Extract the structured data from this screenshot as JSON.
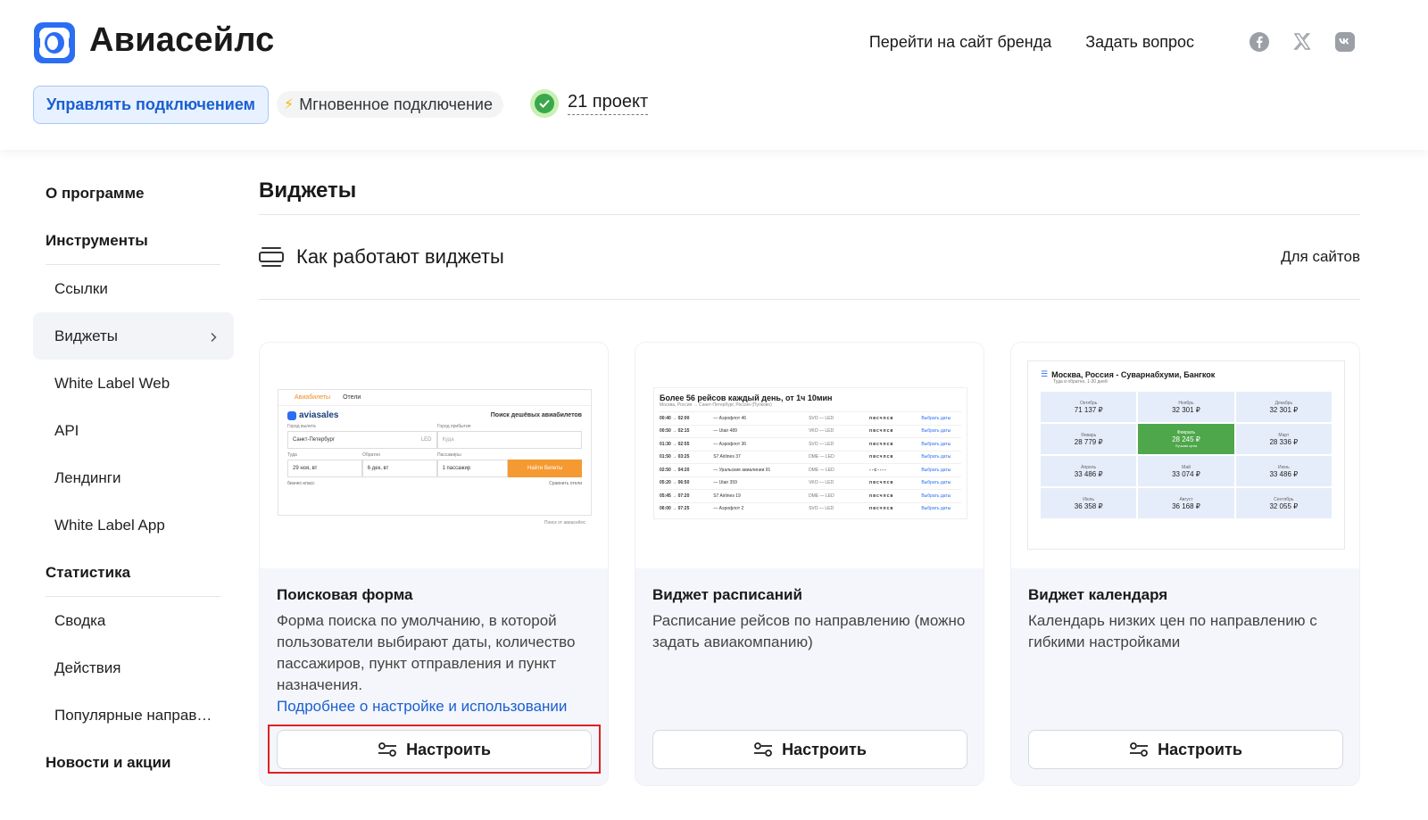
{
  "header": {
    "brand": "Авиасейлс",
    "links": [
      "Перейти на сайт бренда",
      "Задать вопрос"
    ],
    "social_icons": [
      "facebook-icon",
      "x-icon",
      "vk-icon"
    ],
    "manage_button": "Управлять подключением",
    "instant_badge": "Мгновенное подключение",
    "projects": "21 проект"
  },
  "sidebar": {
    "about": "О программе",
    "tools_title": "Инструменты",
    "tools": [
      "Ссылки",
      "Виджеты",
      "White Label Web",
      "API",
      "Лендинги",
      "White Label App"
    ],
    "active_item": "Виджеты",
    "stats_title": "Статистика",
    "stats": [
      "Сводка",
      "Действия",
      "Популярные направ…"
    ],
    "news": "Новости и акции"
  },
  "main": {
    "title": "Виджеты",
    "how_title": "Как работают виджеты",
    "for_sites": "Для сайтов",
    "configure_label": "Настроить",
    "cards": [
      {
        "title": "Поисковая форма",
        "desc": "Форма поиска по умолчанию, в которой пользователи выбирают даты, количество пассажиров, пункт отправления и пункт назначения.",
        "link": "Подробнее о настройке и использовании"
      },
      {
        "title": "Виджет расписаний",
        "desc": "Расписание рейсов по направлению (можно задать авиакомпанию)"
      },
      {
        "title": "Виджет календаря",
        "desc": "Календарь низких цен по направлению с гибкими настройками"
      }
    ]
  },
  "preview_search": {
    "tab_air": "Авиабилеты",
    "tab_hotels": "Отели",
    "logo": "aviasales",
    "heading": "Поиск дешёвых авиабилетов",
    "label_from": "Город вылета",
    "label_to": "Город прибытия",
    "from": "Санкт-Петербург",
    "from_code": "LED",
    "to": "Куда",
    "label_there": "Туда",
    "label_back": "Обратно",
    "label_pax": "Пассажиры",
    "date_there": "29 ноя, вт",
    "date_back": "6 дек, вт",
    "pax": "1 пассажир",
    "find_button": "Найти билеты",
    "business": "бизнес-класс",
    "compare": "Сравнить отели",
    "powered": "Поиск от",
    "powered_brand": "авиасейлс"
  },
  "preview_schedule": {
    "title": "Более 56 рейсов каждый день, от 1ч 10мин",
    "subtitle": "Москва, Россия → Санкт-Петербург, Россия (Пулково)",
    "rows": [
      {
        "time": "00:40 → 02:00",
        "airline": "— Аэрофлот 46",
        "route": "SVO — LED",
        "days": "пвсчпсв",
        "link": "Выбрать даты"
      },
      {
        "time": "00:50 → 02:15",
        "airline": "— Utair 489",
        "route": "VKO — LED",
        "days": "пвсчпсв",
        "link": "Выбрать даты"
      },
      {
        "time": "01:30 → 02:55",
        "airline": "— Аэрофлот 36",
        "route": "SVO — LED",
        "days": "пвсчпсв",
        "link": "Выбрать даты"
      },
      {
        "time": "01:50 → 03:25",
        "airline": "S7 Airlines 37",
        "route": "DME — LED",
        "days": "пвсчпсв",
        "link": "Выбрать даты"
      },
      {
        "time": "02:50 → 04:20",
        "airline": "— Уральские авиалинии 91",
        "route": "DME — LED",
        "days": "--с----",
        "link": "Выбрать даты"
      },
      {
        "time": "05:20 → 06:50",
        "airline": "— Utair 359",
        "route": "VKO — LED",
        "days": "пвсчпсв",
        "link": "Выбрать даты"
      },
      {
        "time": "05:45 → 07:20",
        "airline": "S7 Airlines 19",
        "route": "DME — LED",
        "days": "пвсчпсв",
        "link": "Выбрать даты"
      },
      {
        "time": "06:00 → 07:25",
        "airline": "— Аэрофлот 2",
        "route": "SVO — LED",
        "days": "пвсчпсв",
        "link": "Выбрать даты"
      }
    ]
  },
  "preview_calendar": {
    "title": "Москва, Россия - Суварнабхуми, Бангкок",
    "subtitle": "Туда и обратно, 1-30 дней",
    "best_note": "Лучшая цена",
    "cells": [
      {
        "month": "Октябрь",
        "price": "71 137 ₽",
        "best": false
      },
      {
        "month": "Ноябрь",
        "price": "32 301 ₽",
        "best": false
      },
      {
        "month": "Декабрь",
        "price": "32 301 ₽",
        "best": false
      },
      {
        "month": "Январь",
        "price": "28 779 ₽",
        "best": false
      },
      {
        "month": "Февраль",
        "price": "28 245 ₽",
        "best": true
      },
      {
        "month": "Март",
        "price": "28 336 ₽",
        "best": false
      },
      {
        "month": "Апрель",
        "price": "33 486 ₽",
        "best": false
      },
      {
        "month": "Май",
        "price": "33 074 ₽",
        "best": false
      },
      {
        "month": "Июнь",
        "price": "33 486 ₽",
        "best": false
      },
      {
        "month": "Июль",
        "price": "36 358 ₽",
        "best": false
      },
      {
        "month": "Август",
        "price": "36 168 ₽",
        "best": false
      },
      {
        "month": "Сентябрь",
        "price": "32 055 ₽",
        "best": false
      }
    ]
  },
  "colors": {
    "accent_blue": "#1b5fd1",
    "highlight_red": "#e02020",
    "success_green": "#3aa84a"
  }
}
